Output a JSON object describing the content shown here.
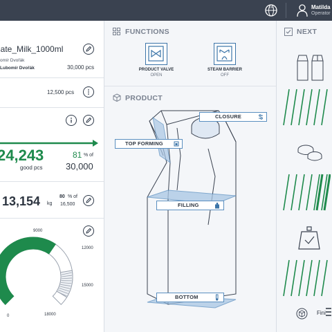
{
  "header": {
    "language": "EN",
    "user_name": "Matilda I",
    "user_role": "Operator"
  },
  "left": {
    "order_name": "late_Milk_1000ml",
    "operator_partial": "omír Dvořák",
    "operator": "Lubomír Dvořák",
    "target_qty": "30,000 pcs",
    "qty2": "12,500 pcs",
    "good_value": "24,243",
    "good_label": "good pcs",
    "good_pct": "81",
    "pct_of": "% of",
    "good_target": "30,000",
    "weight_value": "13,154",
    "weight_unit": "kg",
    "weight_pct": "80",
    "weight_target": "16,500",
    "gauge_ticks": [
      "0",
      "9000",
      "12000",
      "15000",
      "18000"
    ],
    "gauge_value": 6800,
    "gauge_max": 18000
  },
  "functions": {
    "title": "FUNCTIONS",
    "items": [
      {
        "label": "PRODUCT VALVE",
        "state": "OPEN",
        "icon": "valve-icon"
      },
      {
        "label": "STEAM BARRIER",
        "state": "OFF",
        "icon": "steam-barrier-icon"
      }
    ]
  },
  "product": {
    "title": "PRODUCT",
    "tags": {
      "closure": "CLOSURE",
      "top_forming": "TOP FORMING",
      "filling": "FILLING",
      "bottom": "BOTTOM"
    }
  },
  "next": {
    "title": "NEXT",
    "footer_partial": "Fini"
  },
  "colors": {
    "accent_green": "#1e8a4c",
    "accent_blue": "#3b74a8",
    "topbar": "#3a4250"
  }
}
